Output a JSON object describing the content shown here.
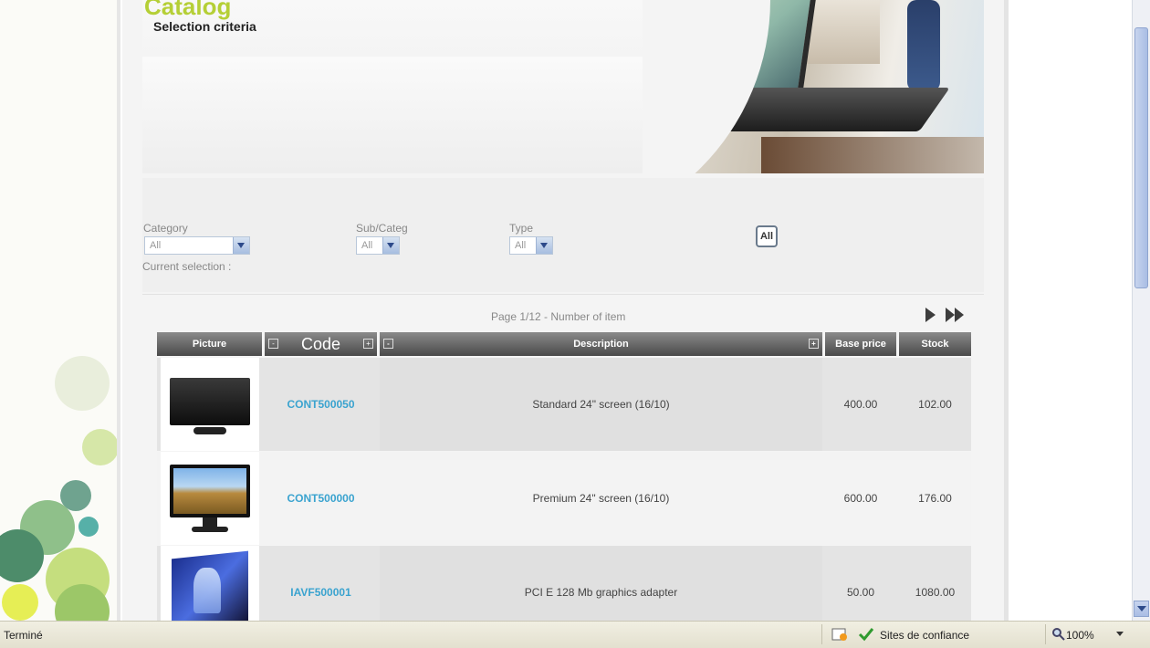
{
  "header": {
    "title": "Catalog",
    "subtitle": "Selection criteria"
  },
  "filters": {
    "category": {
      "label": "Category",
      "value": "All"
    },
    "subcateg": {
      "label": "Sub/Categ",
      "value": "All"
    },
    "type": {
      "label": "Type",
      "value": "All"
    },
    "current_selection": "Current selection :",
    "all_button": "All"
  },
  "paging": {
    "text": "Page 1/12 - Number of item"
  },
  "table": {
    "columns": [
      "Picture",
      "Code",
      "Description",
      "Base price",
      "Stock"
    ],
    "rows": [
      {
        "code": "CONT500050",
        "description": "Standard 24\" screen (16/10)",
        "price": "400.00",
        "stock": "102.00",
        "picture": "black-monitor"
      },
      {
        "code": "CONT500000",
        "description": "Premium 24\" screen (16/10)",
        "price": "600.00",
        "stock": "176.00",
        "picture": "landscape-monitor"
      },
      {
        "code": "IAVF500001",
        "description": "PCI E 128 Mb graphics adapter",
        "price": "50.00",
        "stock": "1080.00",
        "picture": "graphics-card-box"
      }
    ]
  },
  "statusbar": {
    "status": "Terminé",
    "zone": "Sites de confiance",
    "zoom": "100%"
  },
  "colors": {
    "accent": "#b5cf36",
    "code_link": "#3aa3cf",
    "header_dark": "#4a4a4a"
  }
}
